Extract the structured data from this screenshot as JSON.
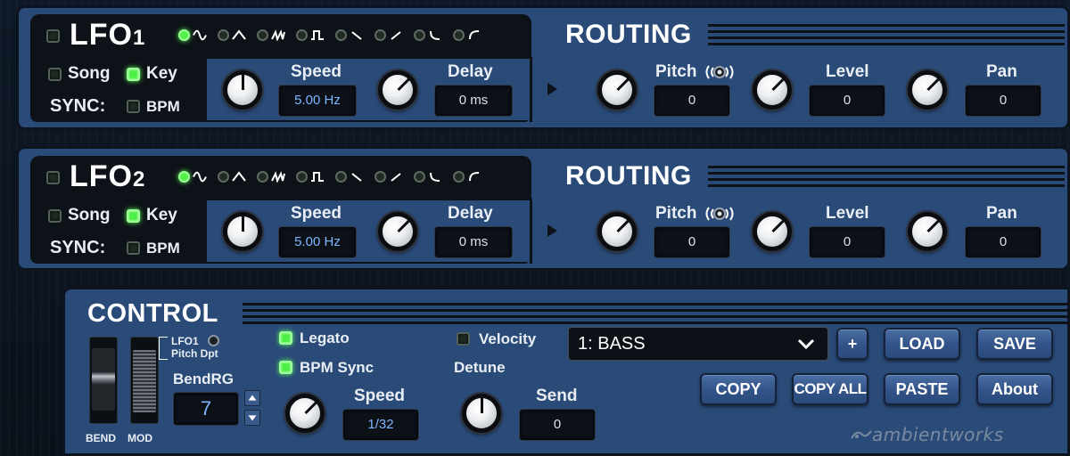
{
  "lfos": [
    {
      "title_main": "LFO",
      "title_num": "1",
      "active_wave": "sine",
      "waves": [
        "sine-icon",
        "triangle-icon",
        "ramp-up-icon",
        "square-icon",
        "ramp-down-icon",
        "saw-up-icon",
        "exp-down-icon",
        "exp-up-icon"
      ],
      "sync": {
        "label": "SYNC:",
        "song": "Song",
        "key": "Key",
        "bpm": "BPM",
        "song_on": false,
        "key_on": true,
        "bpm_on": false
      },
      "speed": {
        "label": "Speed",
        "value": "5.00 Hz"
      },
      "delay": {
        "label": "Delay",
        "value": "0 ms"
      },
      "routing": {
        "title": "ROUTING",
        "pitch": {
          "label": "Pitch",
          "value": "0"
        },
        "level": {
          "label": "Level",
          "value": "0"
        },
        "pan": {
          "label": "Pan",
          "value": "0"
        }
      }
    },
    {
      "title_main": "LFO",
      "title_num": "2",
      "active_wave": "sine",
      "waves": [
        "sine-icon",
        "triangle-icon",
        "ramp-up-icon",
        "square-icon",
        "ramp-down-icon",
        "saw-up-icon",
        "exp-down-icon",
        "exp-up-icon"
      ],
      "sync": {
        "label": "SYNC:",
        "song": "Song",
        "key": "Key",
        "bpm": "BPM",
        "song_on": false,
        "key_on": true,
        "bpm_on": false
      },
      "speed": {
        "label": "Speed",
        "value": "5.00 Hz"
      },
      "delay": {
        "label": "Delay",
        "value": "0 ms"
      },
      "routing": {
        "title": "ROUTING",
        "pitch": {
          "label": "Pitch",
          "value": "0"
        },
        "level": {
          "label": "Level",
          "value": "0"
        },
        "pan": {
          "label": "Pan",
          "value": "0"
        }
      }
    }
  ],
  "control": {
    "title": "CONTROL",
    "bend_label": "BEND",
    "mod_label": "MOD",
    "lfo_pitch_label_1": "LFO1",
    "lfo_pitch_label_2": "Pitch Dpt",
    "bendrg_label": "BendRG",
    "bendrg_value": "7",
    "legato": "Legato",
    "legato_on": true,
    "bpm_sync": "BPM Sync",
    "bpm_sync_on": true,
    "velocity": "Velocity",
    "velocity_on": false,
    "detune": "Detune",
    "speed_label": "Speed",
    "speed_value": "1/32",
    "send_label": "Send",
    "send_value": "0",
    "preset": "1: BASS",
    "plus": "+",
    "load": "LOAD",
    "save": "SAVE",
    "copy": "COPY",
    "copy_all": "COPY ALL",
    "paste": "PASTE",
    "about": "About",
    "brand": "ambientworks"
  },
  "colors": {
    "panel": "#2a4a78",
    "dark": "#0d1218",
    "led_on": "#4cf046",
    "value_text": "#7fb6ff"
  }
}
